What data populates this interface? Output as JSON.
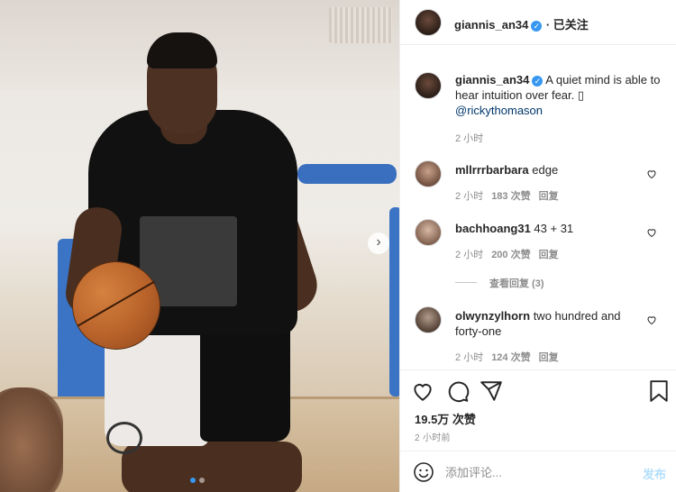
{
  "post": {
    "username": "giannis_an34",
    "follow_label": "· 已关注",
    "caption": "A quiet mind is able to hear intuition over fear. ",
    "caption_glyph": "▯",
    "mention": "@rickythomason",
    "caption_time": "2 小时"
  },
  "comments": [
    {
      "username": "mllrrrbarbara",
      "text": "edge",
      "time": "2 小时",
      "likes": "183 次赞",
      "reply": "回复"
    },
    {
      "username": "bachhoang31",
      "text": "43 + 31",
      "time": "2 小时",
      "likes": "200 次赞",
      "reply": "回复",
      "view_replies": "查看回复 (3)"
    },
    {
      "username": "olwynzylhorn",
      "text": "two hundred and forty-one",
      "time": "2 小时",
      "likes": "124 次赞",
      "reply": "回复"
    }
  ],
  "stats": {
    "likes": "19.5万 次赞",
    "time_ago": "2 小时前"
  },
  "add_comment": {
    "placeholder": "添加评论...",
    "post_label": "发布"
  },
  "icons": {
    "like": "heart-icon",
    "comment": "comment-icon",
    "share": "share-icon",
    "save": "bookmark-icon",
    "emoji": "emoji-icon",
    "next": "chevron-right-icon",
    "verified": "verified-icon"
  },
  "colors": {
    "verified_blue": "#3897f0",
    "link": "#00376b",
    "post_button_disabled": "#b2dffc",
    "meta_gray": "#8e8e8e"
  },
  "carousel": {
    "slide_count": 2,
    "active_index": 0
  }
}
